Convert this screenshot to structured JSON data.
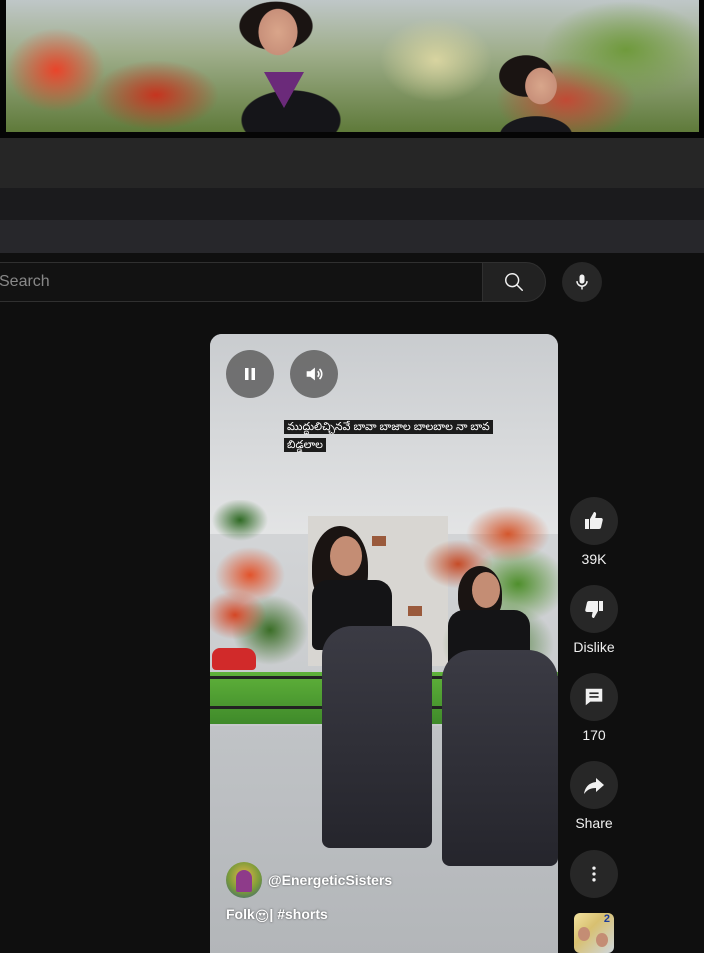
{
  "search": {
    "placeholder": "Search"
  },
  "player": {
    "caption": "ముద్దులిచ్చినవే బావా బాజాల బాలబాల నా బావ బిడ్డలాల",
    "channel_handle": "@EnergeticSisters",
    "title_prefix": "Folk",
    "title_emoji": "😍",
    "title_suffix": "| #shorts"
  },
  "actions": {
    "like_count": "39K",
    "dislike_label": "Dislike",
    "comment_count": "170",
    "share_label": "Share"
  },
  "next_short": {
    "badge": "2"
  },
  "icons": {
    "search": "search-icon",
    "mic": "mic-icon",
    "pause": "pause-icon",
    "volume": "volume-icon",
    "like": "thumbs-up-icon",
    "dislike": "thumbs-down-icon",
    "comment": "comment-icon",
    "share": "share-icon",
    "more": "more-vertical-icon"
  },
  "colors": {
    "background": "#0f0f0f",
    "button": "#272727",
    "text": "#f1f1f1"
  }
}
